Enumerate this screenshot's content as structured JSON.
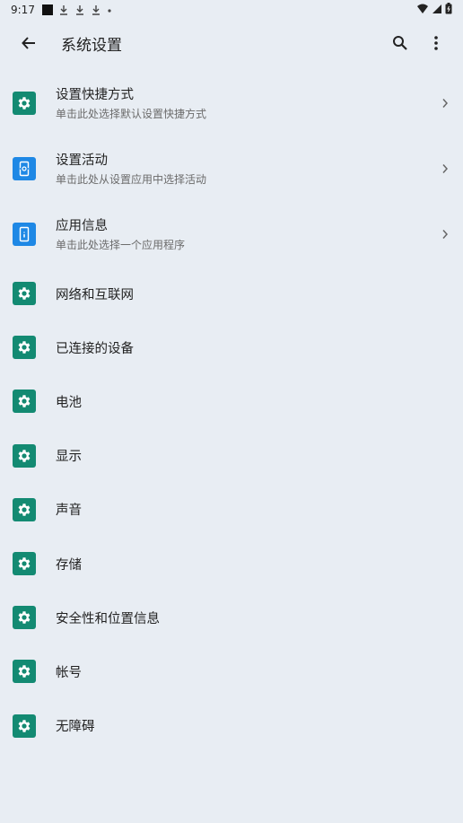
{
  "status_bar": {
    "time": "9:17"
  },
  "appbar": {
    "title": "系统设置"
  },
  "items": [
    {
      "label": "设置快捷方式",
      "subtitle": "单击此处选择默认设置快捷方式"
    },
    {
      "label": "设置活动",
      "subtitle": "单击此处从设置应用中选择活动"
    },
    {
      "label": "应用信息",
      "subtitle": "单击此处选择一个应用程序"
    },
    {
      "label": "网络和互联网"
    },
    {
      "label": "已连接的设备"
    },
    {
      "label": "电池"
    },
    {
      "label": "显示"
    },
    {
      "label": "声音"
    },
    {
      "label": "存储"
    },
    {
      "label": "安全性和位置信息"
    },
    {
      "label": "帐号"
    },
    {
      "label": "无障碍"
    }
  ],
  "colors": {
    "background": "#e8edf3",
    "icon_green": "#138a72",
    "icon_blue": "#1e88e5"
  }
}
